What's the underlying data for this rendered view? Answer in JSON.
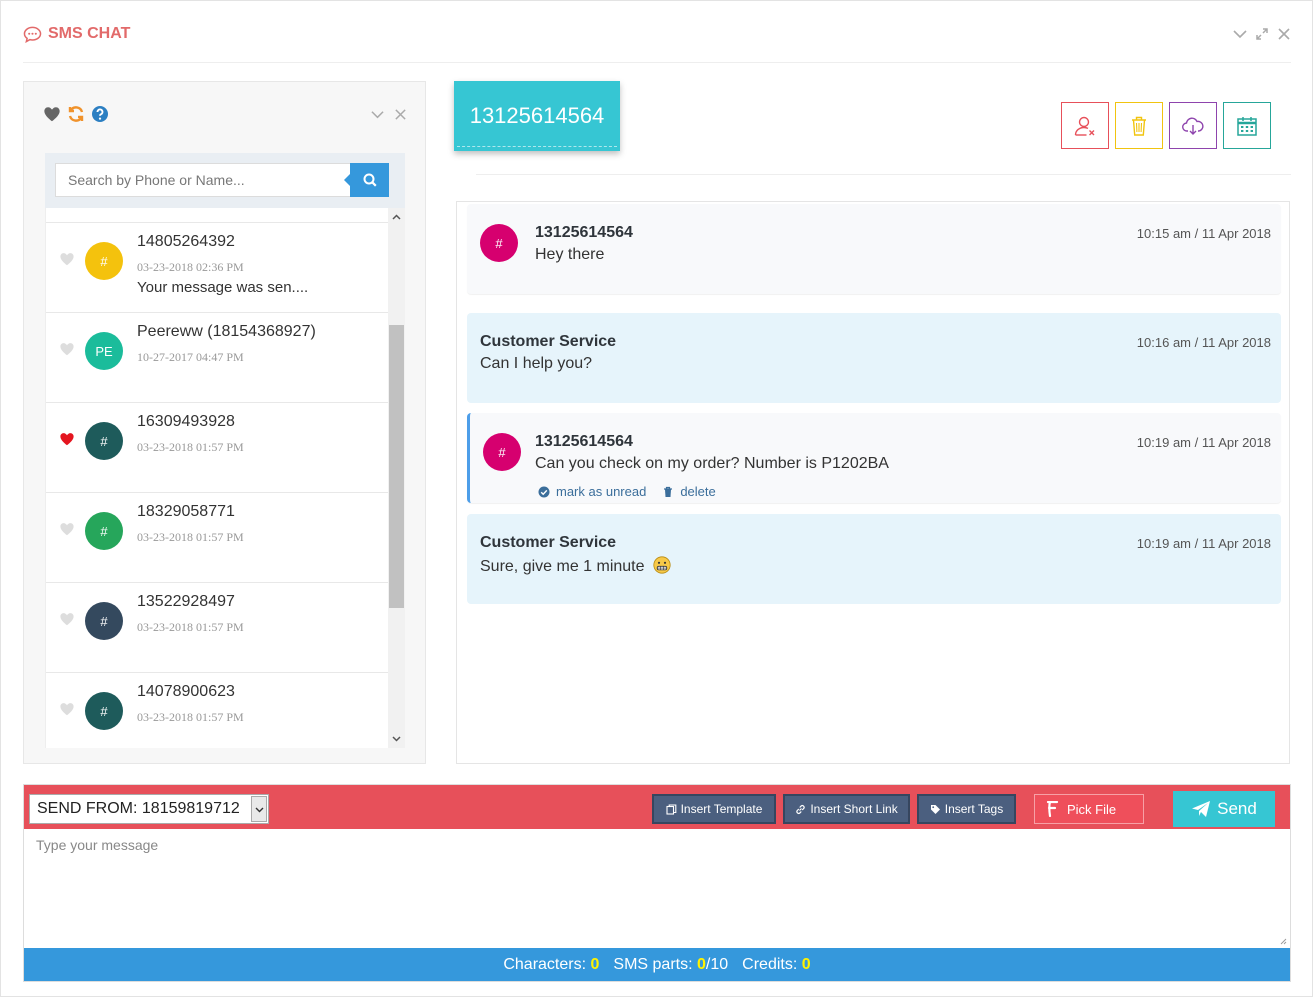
{
  "app": {
    "title": "SMS CHAT",
    "accent": "#e26a6a"
  },
  "contacts_panel": {
    "search": {
      "placeholder": "Search by Phone or Name..."
    },
    "items": [
      {
        "name": "14805264392",
        "date": "03-23-2018 02:36 PM",
        "preview": "Your message was sen....",
        "avatar": "#",
        "avatar_color": "#f4c20d",
        "favorite": false
      },
      {
        "name": "Peereww (18154368927)",
        "date": "10-27-2017 04:47 PM",
        "preview": "",
        "avatar": "PE",
        "avatar_color": "#1bbc9b",
        "favorite": false
      },
      {
        "name": "16309493928",
        "date": "03-23-2018 01:57 PM",
        "preview": "",
        "avatar": "#",
        "avatar_color": "#1e5b5b",
        "favorite": true
      },
      {
        "name": "18329058771",
        "date": "03-23-2018 01:57 PM",
        "preview": "",
        "avatar": "#",
        "avatar_color": "#26a65b",
        "favorite": false
      },
      {
        "name": "13522928497",
        "date": "03-23-2018 01:57 PM",
        "preview": "",
        "avatar": "#",
        "avatar_color": "#34495e",
        "favorite": false
      },
      {
        "name": "14078900623",
        "date": "03-23-2018 01:57 PM",
        "preview": "",
        "avatar": "#",
        "avatar_color": "#1e5b5b",
        "favorite": false
      }
    ]
  },
  "conversation": {
    "phone": "13125614564",
    "messages": [
      {
        "direction": "in",
        "sender": "13125614564",
        "avatar": "#",
        "text": "Hey there",
        "time": "10:15 am / 11 Apr 2018"
      },
      {
        "direction": "out",
        "sender": "Customer Service",
        "text": "Can I help you?",
        "time": "10:16 am / 11 Apr 2018"
      },
      {
        "direction": "in",
        "sender": "13125614564",
        "avatar": "#",
        "text": "Can you check on my order? Number is P1202BA",
        "time": "10:19 am / 11 Apr 2018",
        "actions": {
          "mark_unread": "mark as unread",
          "delete": "delete"
        }
      },
      {
        "direction": "out",
        "sender": "Customer Service",
        "text": "Sure, give me 1 minute",
        "time": "10:19 am / 11 Apr 2018",
        "emoji": "grimacing-emoji"
      }
    ]
  },
  "composer": {
    "send_from": "SEND FROM: 18159819712",
    "insert_template": "Insert Template",
    "insert_short_link": "Insert Short Link",
    "insert_tags": "Insert Tags",
    "pick_file": "Pick File",
    "send": "Send",
    "placeholder": "Type your message",
    "counters": {
      "characters_label": "Characters:",
      "characters": "0",
      "sms_parts_label": "SMS parts:",
      "sms_parts": "0",
      "sms_parts_max": "/10",
      "credits_label": "Credits:",
      "credits": "0"
    }
  }
}
